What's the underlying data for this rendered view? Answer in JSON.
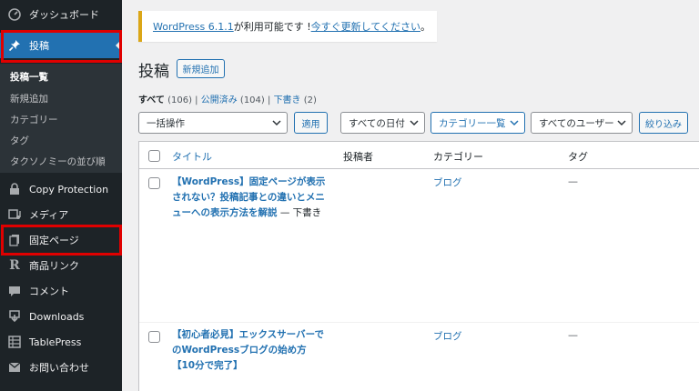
{
  "sidebar": {
    "dashboard": "ダッシュボード",
    "posts": "投稿",
    "submenu": [
      "投稿一覧",
      "新規追加",
      "カテゴリー",
      "タグ",
      "タクソノミーの並び順"
    ],
    "items": [
      "Copy Protection",
      "メディア",
      "固定ページ",
      "商品リンク",
      "コメント",
      "Downloads",
      "TablePress",
      "お問い合わせ"
    ]
  },
  "notice": {
    "version_link": "WordPress 6.1.1",
    "middle": " が利用可能です ! ",
    "update_link": "今すぐ更新してください",
    "end": "。"
  },
  "page": {
    "title": "投稿",
    "add_new": "新規追加"
  },
  "views": {
    "all": "すべて",
    "all_count": "(106)",
    "published": "公開済み",
    "published_count": "(104)",
    "drafts": "下書き",
    "drafts_count": "(2)",
    "sep": "|"
  },
  "filters": {
    "bulk": "一括操作",
    "apply": "適用",
    "dates": "すべての日付",
    "categories": "カテゴリー一覧",
    "users": "すべてのユーザー",
    "filter": "絞り込み"
  },
  "table": {
    "headers": {
      "title": "タイトル",
      "author": "投稿者",
      "category": "カテゴリー",
      "tag": "タグ"
    },
    "rows": [
      {
        "title": "【WordPress】固定ページが表示されない？投稿記事との違いとメニューへの表示方法を解説",
        "state": " — 下書き",
        "category": "ブログ",
        "tag": "—"
      },
      {
        "title": "【初心者必見】エックスサーバーでのWordPressブログの始め方【10分で完了】",
        "state": "",
        "category": "ブログ",
        "tag": "—"
      }
    ]
  },
  "colors": {
    "accent": "#2271b1",
    "sidebar": "#1d2327",
    "highlight": "#e00000",
    "notice_border": "#dba617"
  }
}
